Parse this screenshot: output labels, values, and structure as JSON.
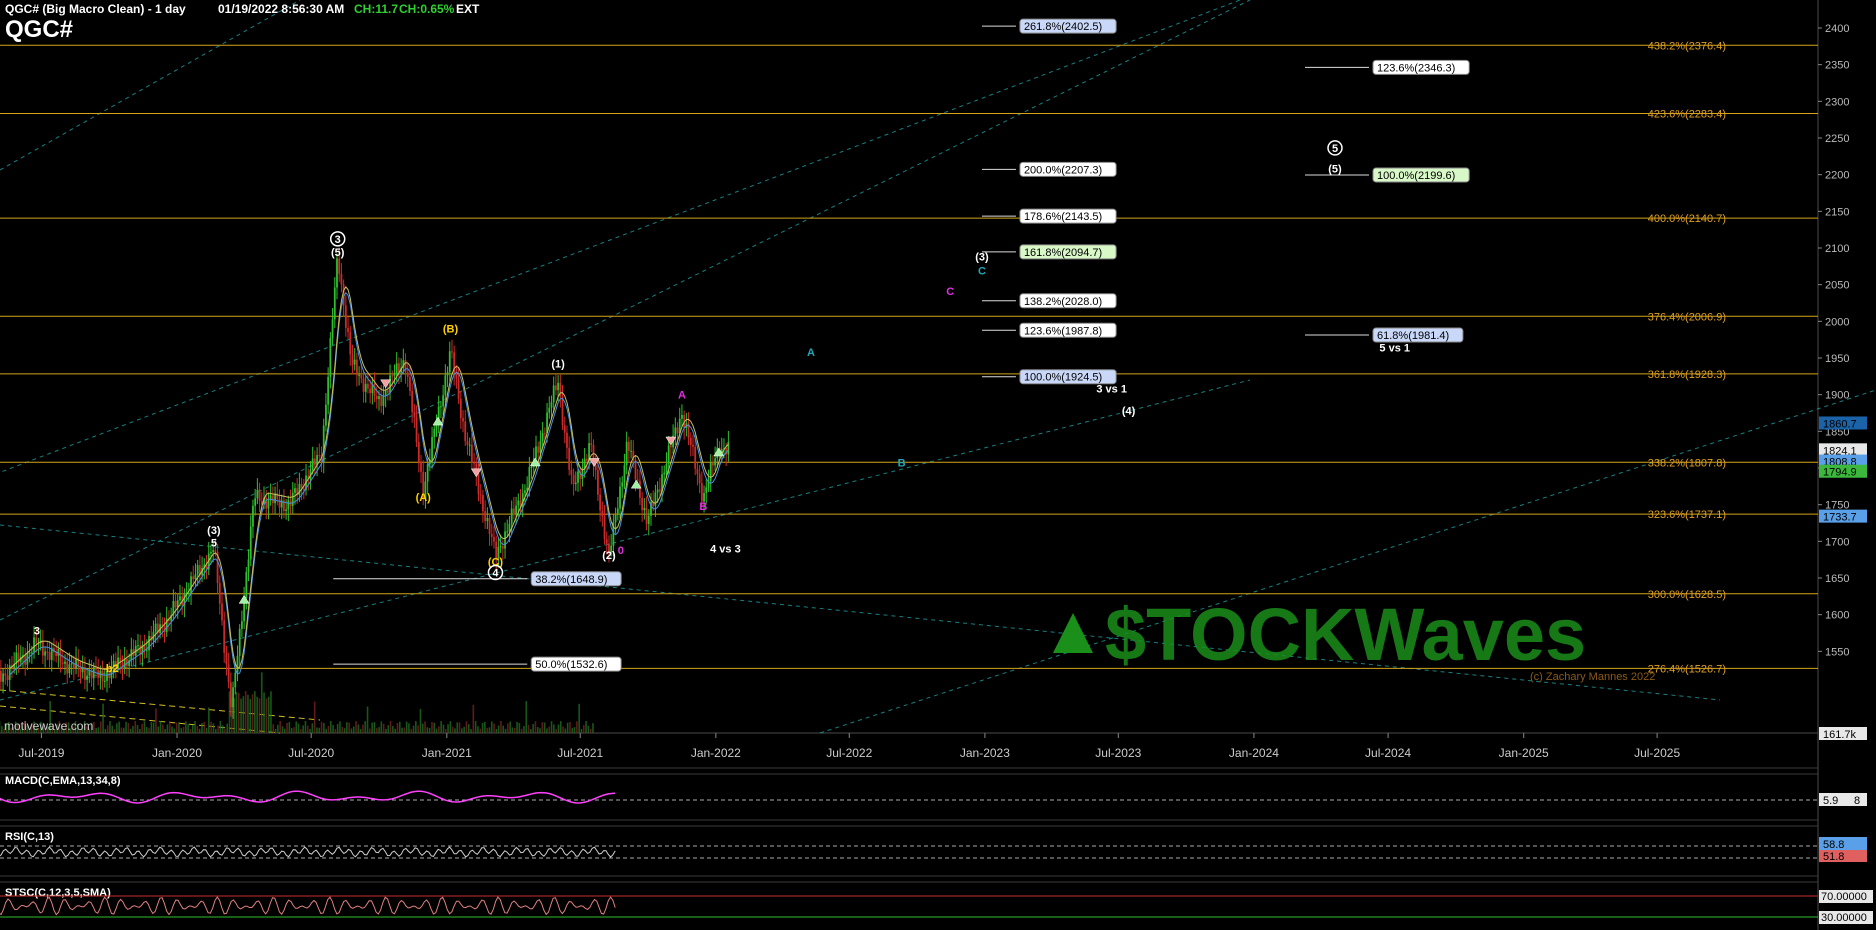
{
  "header": {
    "title": "QGC# (Big Macro Clean) - 1 day",
    "datetime": "01/19/2022 8:56:30 AM",
    "change": "CH:11.7",
    "change_pct": "CH:0.65%",
    "ext": "EXT",
    "symbol": "QGC#"
  },
  "watermark": {
    "source": "motivewave.com",
    "brand": "$TOCKWaves",
    "copyright": "(c) Zachary Mannes 2022"
  },
  "colors": {
    "background": "#000000",
    "fib_line": "#d4a41a",
    "fib_text": "#e0a020",
    "up_candle": "#2fbf2f",
    "down_candle": "#cc2b2b",
    "count_white": "#ffffff",
    "count_yellow": "#ffd200",
    "count_magenta": "#e030e0",
    "count_teal": "#22a8b8",
    "trendline": "#1fa0a0",
    "macd_line": "#ff40ff",
    "brand_green": "#1a8f1a",
    "brand_brown": "#8a5a18"
  },
  "chart_data": {
    "type": "line",
    "title": "QGC# (Big Macro Clean) - 1 day",
    "price_axis": {
      "range": [
        1500,
        2430
      ],
      "ticks": [
        1550,
        1600,
        1650,
        1700,
        1750,
        1800,
        1850,
        1900,
        1950,
        2000,
        2050,
        2100,
        2150,
        2200,
        2250,
        2300,
        2350,
        2400
      ],
      "badges": [
        {
          "label": "1860.7",
          "value": 1860.7,
          "color": "#1a63a8"
        },
        {
          "label": "1824.1",
          "value": 1824.1,
          "color": "#e8e8e8"
        },
        {
          "label": "1808.8",
          "value": 1808.8,
          "color": "#5aa0e8"
        },
        {
          "label": "1794.9",
          "value": 1794.9,
          "color": "#3cb83c"
        },
        {
          "label": "1733.7",
          "value": 1733.7,
          "color": "#5aa0e8"
        },
        {
          "label": "161.7k",
          "value": 1539,
          "color": "#e8e8e8"
        }
      ]
    },
    "time_axis": {
      "labels": [
        "Jul-2019",
        "Jan-2020",
        "Jul-2020",
        "Jan-2021",
        "Jul-2021",
        "Jan-2022",
        "Jul-2022",
        "Jan-2023",
        "Jul-2023",
        "Jan-2024",
        "Jul-2024",
        "Jan-2025",
        "Jul-2025"
      ]
    },
    "price_series": [
      {
        "date": "2019-05-01",
        "value": 1510
      },
      {
        "date": "2019-06-25",
        "value": 1560
      },
      {
        "date": "2019-08-10",
        "value": 1530
      },
      {
        "date": "2019-09-20",
        "value": 1515
      },
      {
        "date": "2019-11-15",
        "value": 1555
      },
      {
        "date": "2019-12-20",
        "value": 1595
      },
      {
        "date": "2020-02-20",
        "value": 1690
      },
      {
        "date": "2020-03-15",
        "value": 1470
      },
      {
        "date": "2020-04-15",
        "value": 1760
      },
      {
        "date": "2020-06-01",
        "value": 1750
      },
      {
        "date": "2020-07-15",
        "value": 1820
      },
      {
        "date": "2020-08-06",
        "value": 2089
      },
      {
        "date": "2020-08-25",
        "value": 1940
      },
      {
        "date": "2020-09-30",
        "value": 1890
      },
      {
        "date": "2020-11-05",
        "value": 1950
      },
      {
        "date": "2020-11-30",
        "value": 1770
      },
      {
        "date": "2021-01-06",
        "value": 1959
      },
      {
        "date": "2021-01-25",
        "value": 1850
      },
      {
        "date": "2021-03-08",
        "value": 1680
      },
      {
        "date": "2021-04-20",
        "value": 1780
      },
      {
        "date": "2021-06-01",
        "value": 1919
      },
      {
        "date": "2021-06-20",
        "value": 1770
      },
      {
        "date": "2021-07-15",
        "value": 1830
      },
      {
        "date": "2021-08-09",
        "value": 1677
      },
      {
        "date": "2021-09-03",
        "value": 1835
      },
      {
        "date": "2021-09-30",
        "value": 1725
      },
      {
        "date": "2021-10-20",
        "value": 1790
      },
      {
        "date": "2021-11-16",
        "value": 1877
      },
      {
        "date": "2021-12-15",
        "value": 1760
      },
      {
        "date": "2022-01-05",
        "value": 1830
      },
      {
        "date": "2022-01-19",
        "value": 1824
      }
    ],
    "fib_levels": [
      {
        "label": "438.2%(2376.4)",
        "value": 2376.4
      },
      {
        "label": "423.6%(2283.4)",
        "value": 2283.4
      },
      {
        "label": "400.0%(2140.7)",
        "value": 2140.7
      },
      {
        "label": "376.4%(2006.9)",
        "value": 2006.9
      },
      {
        "label": "361.8%(1928.3)",
        "value": 1928.3
      },
      {
        "label": "338.2%(1807.8)",
        "value": 1807.8
      },
      {
        "label": "323.6%(1737.1)",
        "value": 1737.1
      },
      {
        "label": "300.0%(1628.5)",
        "value": 1628.5
      },
      {
        "label": "276.4%(1526.7)",
        "value": 1526.7
      }
    ],
    "projection_boxes": [
      {
        "label": "261.8%(2402.5)",
        "value": 2402.5,
        "date": "2022-12-28",
        "kind": "blue"
      },
      {
        "label": "200.0%(2207.3)",
        "value": 2207.3,
        "date": "2022-12-28",
        "kind": "white"
      },
      {
        "label": "178.6%(2143.5)",
        "value": 2143.5,
        "date": "2022-12-28",
        "kind": "white"
      },
      {
        "label": "161.8%(2094.7)",
        "value": 2094.7,
        "date": "2022-12-28",
        "kind": "green"
      },
      {
        "label": "138.2%(2028.0)",
        "value": 2028.0,
        "date": "2022-12-28",
        "kind": "white"
      },
      {
        "label": "123.6%(1987.8)",
        "value": 1987.8,
        "date": "2022-12-28",
        "kind": "white"
      },
      {
        "label": "100.0%(1924.5)",
        "value": 1924.5,
        "date": "2022-12-28",
        "kind": "blue"
      },
      {
        "label": "123.6%(2346.3)",
        "value": 2346.3,
        "date": "2024-04-20",
        "kind": "white"
      },
      {
        "label": "100.0%(2199.6)",
        "value": 2199.6,
        "date": "2024-04-20",
        "kind": "green"
      },
      {
        "label": "61.8%(1981.4)",
        "value": 1981.4,
        "date": "2024-04-20",
        "kind": "blue"
      },
      {
        "label": "38.2%(1648.9)",
        "value": 1648.9,
        "date": "2021-03-05",
        "kind": "blue"
      },
      {
        "label": "50.0%(1532.6)",
        "value": 1532.6,
        "date": "2021-03-05",
        "kind": "white"
      }
    ],
    "wave_labels": [
      {
        "text": "3",
        "date": "2020-08-06",
        "value": 2107,
        "color": "white",
        "circle": true
      },
      {
        "text": "(5)",
        "date": "2020-08-06",
        "value": 2089,
        "color": "white"
      },
      {
        "text": "(B)",
        "date": "2021-01-06",
        "value": 1985,
        "color": "yellow"
      },
      {
        "text": "(1)",
        "date": "2021-06-01",
        "value": 1937,
        "color": "white"
      },
      {
        "text": "A",
        "date": "2021-11-16",
        "value": 1895,
        "color": "magenta"
      },
      {
        "text": "(A)",
        "date": "2020-11-30",
        "value": 1755,
        "color": "yellow"
      },
      {
        "text": "B",
        "date": "2021-12-15",
        "value": 1743,
        "color": "magenta"
      },
      {
        "text": "(C)",
        "date": "2021-03-08",
        "value": 1667,
        "color": "yellow"
      },
      {
        "text": "4",
        "date": "2021-03-08",
        "value": 1652,
        "color": "white",
        "circle": true
      },
      {
        "text": "(2)",
        "date": "2021-08-09",
        "value": 1676,
        "color": "white"
      },
      {
        "text": "0",
        "date": "2021-08-25",
        "value": 1683,
        "color": "magenta"
      },
      {
        "text": "4 vs 3",
        "date": "2022-01-14",
        "value": 1685,
        "color": "white"
      },
      {
        "text": "(3)",
        "date": "2020-02-20",
        "value": 1710,
        "color": "white"
      },
      {
        "text": "5",
        "date": "2020-02-20",
        "value": 1693,
        "color": "white"
      },
      {
        "text": "3",
        "date": "2019-06-25",
        "value": 1573,
        "color": "white"
      },
      {
        "text": "b2",
        "date": "2019-10-05",
        "value": 1522,
        "color": "yellow"
      },
      {
        "text": "A",
        "date": "2022-05-10",
        "value": 1953,
        "color": "teal"
      },
      {
        "text": "B",
        "date": "2022-09-10",
        "value": 1802,
        "color": "teal"
      },
      {
        "text": "C",
        "date": "2022-11-15",
        "value": 2036,
        "color": "magenta"
      },
      {
        "text": "(3)",
        "date": "2022-12-28",
        "value": 2083,
        "color": "white"
      },
      {
        "text": "C",
        "date": "2022-12-28",
        "value": 2064,
        "color": "teal"
      },
      {
        "text": "3 vs 1",
        "date": "2023-06-22",
        "value": 1903,
        "color": "white"
      },
      {
        "text": "(4)",
        "date": "2023-07-15",
        "value": 1873,
        "color": "white"
      },
      {
        "text": "5",
        "date": "2024-04-20",
        "value": 2231,
        "color": "white",
        "circle": true
      },
      {
        "text": "(5)",
        "date": "2024-04-20",
        "value": 2203,
        "color": "white"
      },
      {
        "text": "5 vs 1",
        "date": "2024-07-10",
        "value": 1959,
        "color": "white"
      }
    ],
    "indicators": {
      "macd": {
        "label": "MACD(C,EMA,13,34,8)",
        "value": "5.9",
        "value2": "8"
      },
      "rsi": {
        "label": "RSI(C,13)",
        "value": "58.8",
        "value2": "51.8"
      },
      "stsc": {
        "label": "STSC(C,12,3,5,SMA)",
        "upper": "70.00000",
        "lower": "30.00000"
      }
    }
  }
}
